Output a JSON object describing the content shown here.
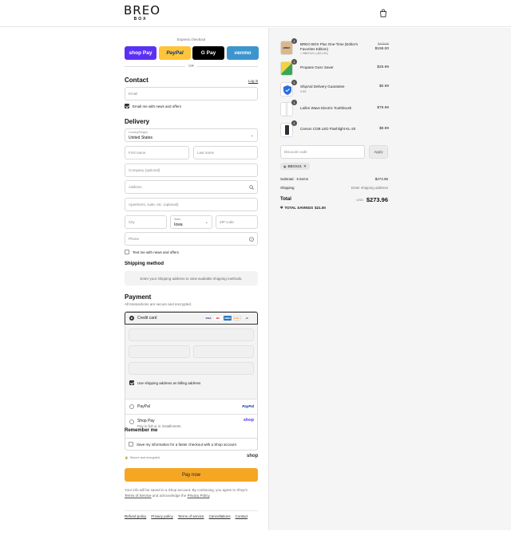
{
  "brand": {
    "name": "BREO",
    "sub": "BOX"
  },
  "express": {
    "label": "Express checkout",
    "buttons": [
      "shop Pay",
      "PayPal",
      "G Pay",
      "venmo"
    ],
    "or": "OR"
  },
  "contact": {
    "title": "Contact",
    "login": "Log in",
    "email_placeholder": "Email",
    "news_label": "Email me with news and offers"
  },
  "delivery": {
    "title": "Delivery",
    "country_label": "Country/Region",
    "country_value": "United States",
    "first_name": "First name",
    "last_name": "Last name",
    "company": "Company (optional)",
    "address": "Address",
    "apartment": "Apartment, suite, etc. (optional)",
    "city": "City",
    "state_label": "State",
    "state_value": "Iowa",
    "zip": "ZIP code",
    "phone": "Phone",
    "text_label": "Text me with news and offers"
  },
  "shipping": {
    "title": "Shipping method",
    "message": "Enter your shipping address to view available shipping methods."
  },
  "payment": {
    "title": "Payment",
    "subtitle": "All transactions are secure and encrypted.",
    "credit_card": "Credit card",
    "cards": [
      "VISA",
      "MC",
      "AMEX",
      "DISC",
      "+5"
    ],
    "billing_label": "Use shipping address as billing address",
    "paypal": "PayPal",
    "paypal_logo": "PayPal",
    "shoppay": "Shop Pay",
    "shoppay_sub": "Pay in full or in installments",
    "shoppay_logo": "shop"
  },
  "remember": {
    "title": "Remember me",
    "label": "Save my information for a faster checkout with a Shop account",
    "secure": "Secure and encrypted",
    "shop_logo": "shop"
  },
  "pay_now": "Pay now",
  "legal": {
    "text1": "Your info will be saved to a Shop account. By continuing, you agree to Shop's",
    "terms": "Terms of Service",
    "text2": "and acknowledge the",
    "privacy": "Privacy Policy",
    "end": "."
  },
  "footer": [
    "Refund policy",
    "Privacy policy",
    "Terms of service",
    "Cancellations",
    "Contact"
  ],
  "cart": {
    "items": [
      {
        "qty": "1",
        "name": "BREO BOX Plus One-Time (Editor's Favorites Edition)",
        "meta": "BBOX21 (-$21.00)",
        "strike": "$179.00",
        "price": "$158.00"
      },
      {
        "qty": "1",
        "name": "Propane Gusc Saver",
        "meta": "",
        "strike": "",
        "price": "$25.99"
      },
      {
        "qty": "1",
        "name": "ShipAid Delivery Guarantee",
        "meta": "0.99",
        "strike": "",
        "price": "$0.99"
      },
      {
        "qty": "1",
        "name": "Laifen Wave Electric Toothbrush",
        "meta": "",
        "strike": "",
        "price": "$79.99"
      },
      {
        "qty": "1",
        "name": "Carson COB LED Flashlight KL-20",
        "meta": "",
        "strike": "",
        "price": "$8.99"
      }
    ],
    "discount_placeholder": "Discount code",
    "apply": "Apply",
    "code": "BBOX21",
    "subtotal_label": "Subtotal · 5 items",
    "subtotal": "$273.96",
    "shipping_label": "Shipping",
    "shipping_value": "Enter shipping address",
    "total_label": "Total",
    "currency": "USD",
    "total": "$273.96",
    "savings_label": "TOTAL SAVINGS",
    "savings": "$21.00"
  }
}
